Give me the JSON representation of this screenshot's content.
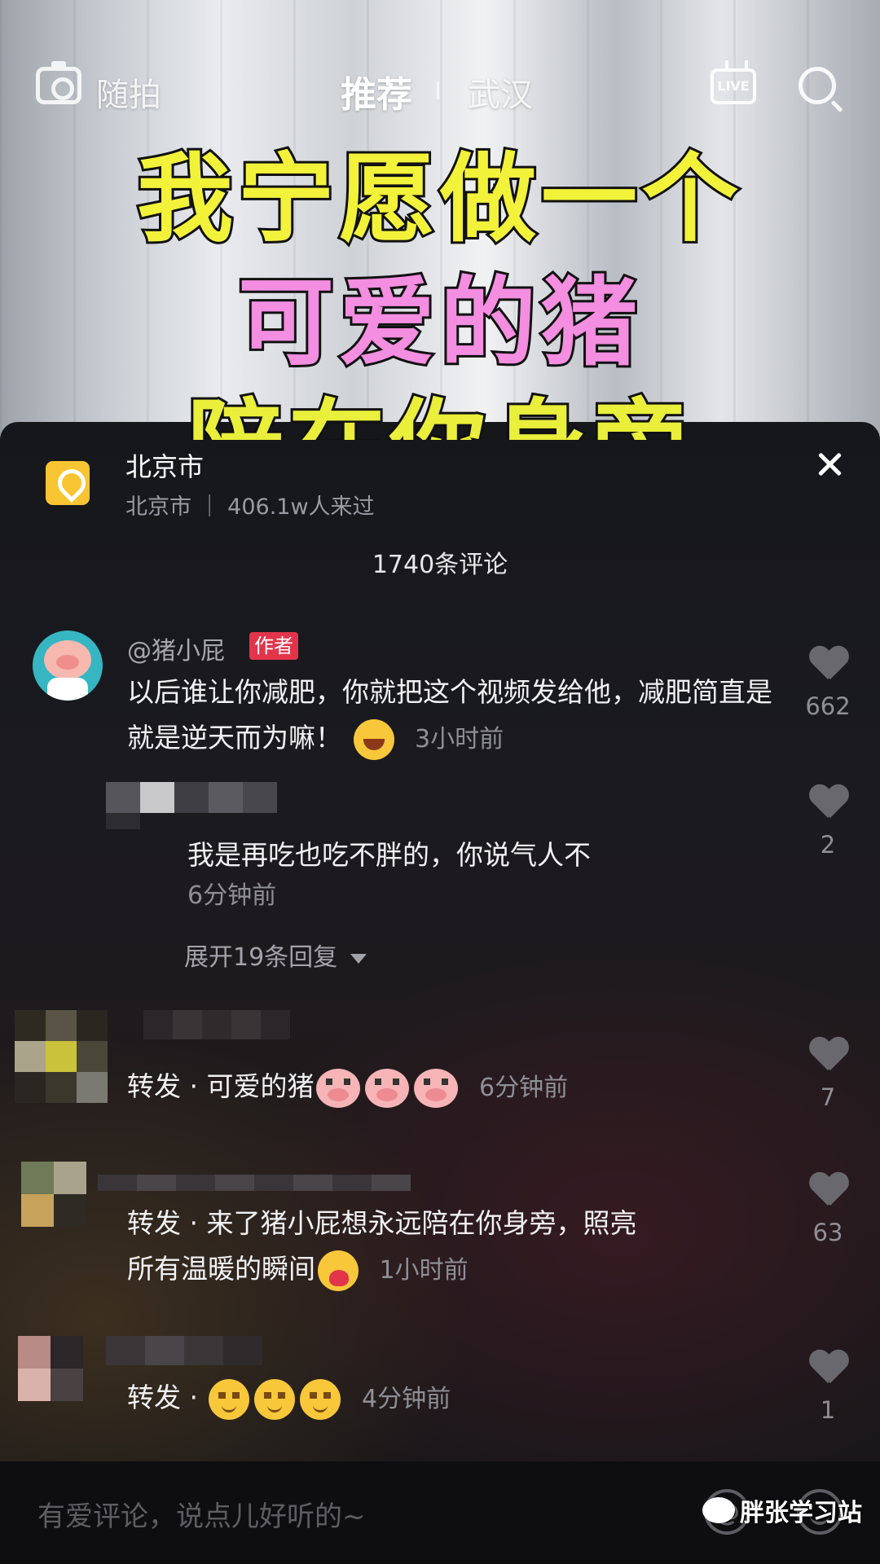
{
  "top_nav": {
    "shoot_label": "随拍",
    "tab_recommend": "推荐",
    "tab_city": "武汉",
    "live_label": "LIVE"
  },
  "video": {
    "caption_lines": [
      "我宁愿做一个",
      "可爱的猪",
      "陪在你身旁"
    ]
  },
  "location": {
    "name": "北京市",
    "subtitle": "北京市 ｜ 406.1w人来过"
  },
  "comments_count": "1740条评论",
  "comments": [
    {
      "username": "@猪小屁",
      "badge": "作者",
      "text": "以后谁让你减肥，你就把这个视频发给他，减肥简直是就是逆天而为嘛！",
      "emoji": "laughing-crying-emoji",
      "time": "3小时前",
      "likes": "662"
    },
    {
      "text": "我是再吃也吃不胖的，你说气人不",
      "time": "6分钟前",
      "likes": "2",
      "expand_label": "展开19条回复"
    },
    {
      "text": "转发 · 可爱的猪",
      "emoji": "pig-face-emoji",
      "time": "6分钟前",
      "likes": "7"
    },
    {
      "text_line1": "转发 · 来了猪小屁想永远陪在你身旁，照亮",
      "text_line2": "所有温暖的瞬间",
      "emoji": "hug-emoji",
      "time": "1小时前",
      "likes": "63"
    },
    {
      "text": "转发 ·",
      "emoji": "smug-face-emoji",
      "time": "4分钟前",
      "likes": "1"
    }
  ],
  "input": {
    "placeholder": "有爱评论，说点儿好听的~"
  },
  "watermark": "胖张学习站",
  "colors": {
    "author_badge": "#e2344b",
    "location_icon": "#f7c531",
    "sheet_bg": "#1a1a1f"
  }
}
